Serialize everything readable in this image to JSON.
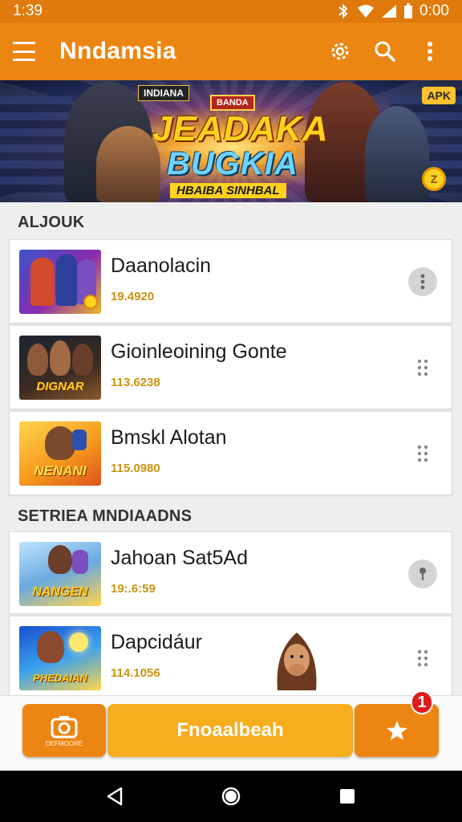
{
  "status": {
    "left": "1:39",
    "time": "0:00"
  },
  "appbar": {
    "title": "Nndamsia",
    "menu_icon": "hamburger-icon",
    "actions": [
      "settings-icon",
      "search-icon",
      "overflow-icon"
    ]
  },
  "banner": {
    "tag_top": "INDIANA",
    "tag_mid": "BANDA",
    "line1": "JEADAKA",
    "line2": "BUGKIA",
    "subtitle": "HBAIBA SINHBAL",
    "apk_badge": "APK",
    "coin": "Z"
  },
  "sections": [
    {
      "label": "ALJOUK",
      "items": [
        {
          "name": "Daanolacin",
          "meta": "19.4920",
          "thumb_caption": ""
        },
        {
          "name": "Gioinleoining Gonte",
          "meta": "113.6238",
          "thumb_caption": "DIGNAR"
        },
        {
          "name": "Bmskl Alotan",
          "meta": "115.0980",
          "thumb_caption": "NENANI"
        }
      ]
    },
    {
      "label": "SETRIEA MNDIAADNS",
      "items": [
        {
          "name": "Jahoan Sat5Ad",
          "meta": "19:.6:59",
          "thumb_caption": "NANGEN"
        },
        {
          "name": "Dapcidáur",
          "meta": "114.1056",
          "thumb_caption": "PHEDAIAN"
        }
      ]
    }
  ],
  "bottombar": {
    "left_label": "DEFMOORE",
    "main_label": "Fnoaalbeah",
    "badge": "1"
  },
  "colors": {
    "primary": "#ec8512",
    "accent": "#f6ae1f",
    "meta": "#c99412",
    "badge": "#e01b1b"
  }
}
